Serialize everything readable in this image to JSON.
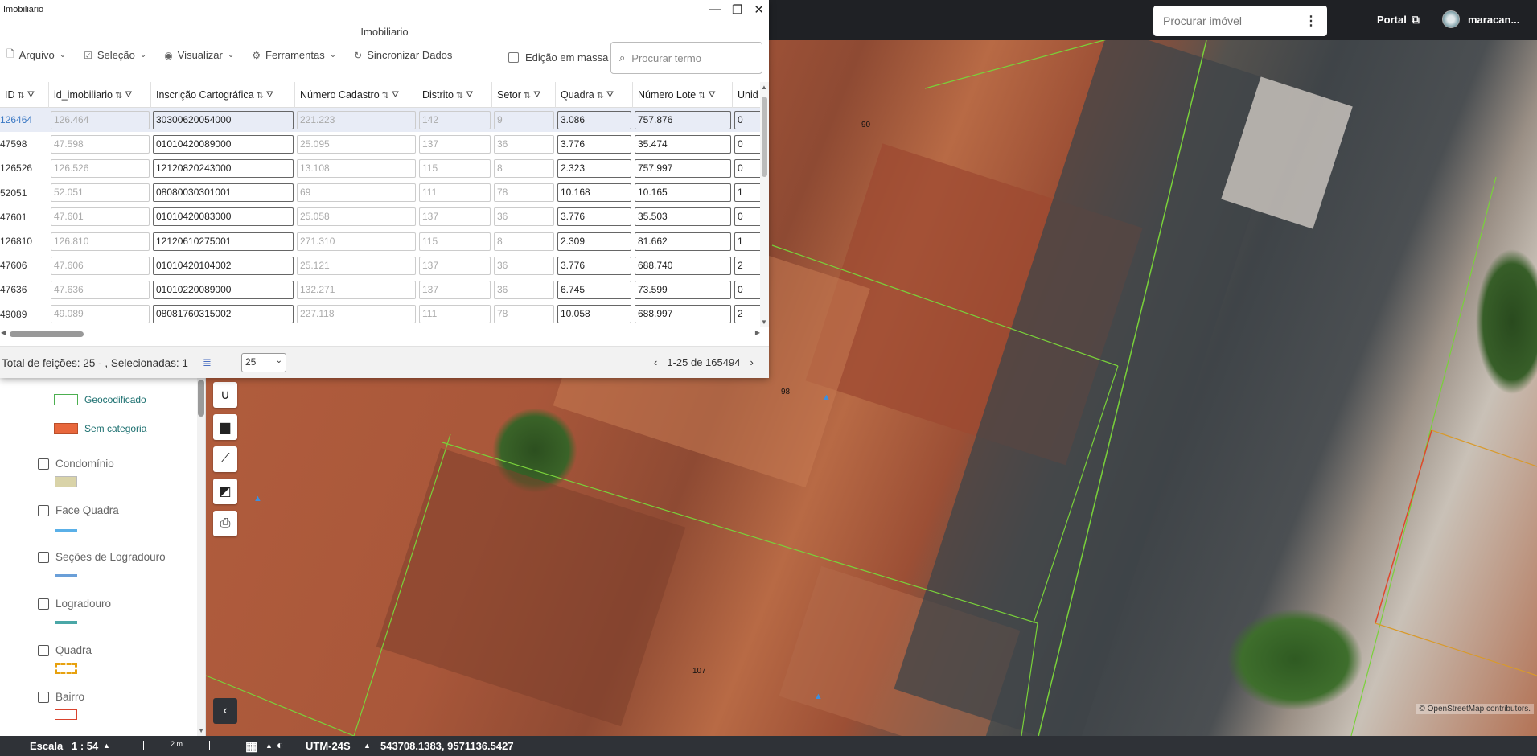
{
  "window": {
    "title": "Imobiliario",
    "heading": "Imobiliario",
    "menu": [
      {
        "label": "Arquivo",
        "icon": "file-icon"
      },
      {
        "label": "Seleção",
        "icon": "checkbox-icon"
      },
      {
        "label": "Visualizar",
        "icon": "eye-icon"
      },
      {
        "label": "Ferramentas",
        "icon": "gear-icon"
      },
      {
        "label": "Sincronizar Dados",
        "icon": "sync-icon"
      }
    ],
    "bulk_edit_label": "Edição em massa",
    "search_placeholder": "Procurar termo"
  },
  "table": {
    "columns": [
      "ID",
      "id_imobiliario",
      "Inscrição Cartográfica",
      "Número Cadastro",
      "Distrito",
      "Setor",
      "Quadra",
      "Número Lote",
      "Unid"
    ],
    "rows": [
      {
        "id": "126464",
        "id_imobiliario": "126.464",
        "inscricao": "30300620054000",
        "cadastro": "221.223",
        "distrito": "142",
        "setor": "9",
        "quadra": "3.086",
        "lote": "757.876",
        "unid": "0",
        "selected": true
      },
      {
        "id": "47598",
        "id_imobiliario": "47.598",
        "inscricao": "01010420089000",
        "cadastro": "25.095",
        "distrito": "137",
        "setor": "36",
        "quadra": "3.776",
        "lote": "35.474",
        "unid": "0"
      },
      {
        "id": "126526",
        "id_imobiliario": "126.526",
        "inscricao": "12120820243000",
        "cadastro": "13.108",
        "distrito": "115",
        "setor": "8",
        "quadra": "2.323",
        "lote": "757.997",
        "unid": "0"
      },
      {
        "id": "52051",
        "id_imobiliario": "52.051",
        "inscricao": "08080030301001",
        "cadastro": "69",
        "distrito": "111",
        "setor": "78",
        "quadra": "10.168",
        "lote": "10.165",
        "unid": "1"
      },
      {
        "id": "47601",
        "id_imobiliario": "47.601",
        "inscricao": "01010420083000",
        "cadastro": "25.058",
        "distrito": "137",
        "setor": "36",
        "quadra": "3.776",
        "lote": "35.503",
        "unid": "0"
      },
      {
        "id": "126810",
        "id_imobiliario": "126.810",
        "inscricao": "12120610275001",
        "cadastro": "271.310",
        "distrito": "115",
        "setor": "8",
        "quadra": "2.309",
        "lote": "81.662",
        "unid": "1"
      },
      {
        "id": "47606",
        "id_imobiliario": "47.606",
        "inscricao": "01010420104002",
        "cadastro": "25.121",
        "distrito": "137",
        "setor": "36",
        "quadra": "3.776",
        "lote": "688.740",
        "unid": "2"
      },
      {
        "id": "47636",
        "id_imobiliario": "47.636",
        "inscricao": "01010220089000",
        "cadastro": "132.271",
        "distrito": "137",
        "setor": "36",
        "quadra": "6.745",
        "lote": "73.599",
        "unid": "0"
      },
      {
        "id": "49089",
        "id_imobiliario": "49.089",
        "inscricao": "08081760315002",
        "cadastro": "227.118",
        "distrito": "111",
        "setor": "78",
        "quadra": "10.058",
        "lote": "688.997",
        "unid": "2"
      }
    ]
  },
  "footer": {
    "total_text": "Total de feições: 25 - , Selecionadas: 1",
    "page_size": "25",
    "range": "1-25 de 165494"
  },
  "topbar": {
    "property_search_placeholder": "Procurar imóvel",
    "portal_label": "Portal",
    "username": "maracan..."
  },
  "layers": {
    "legend": [
      {
        "label": "Geocodificado",
        "color": "#4caf50"
      },
      {
        "label": "Sem categoria",
        "color": "#e8673c"
      }
    ],
    "items": [
      {
        "label": "Condomínio"
      },
      {
        "label": "Face Quadra"
      },
      {
        "label": "Seções de Logradouro"
      },
      {
        "label": "Logradouro"
      },
      {
        "label": "Quadra"
      },
      {
        "label": "Bairro"
      }
    ]
  },
  "map": {
    "labels": [
      "90",
      "98",
      "107"
    ],
    "attribution": "© OpenStreetMap contributors."
  },
  "status": {
    "scale_label": "Escala",
    "scale_value": "1 : 54",
    "scalebar_text": "2 m",
    "crs": "UTM-24S",
    "coords": "543708.1383, 9571136.5427"
  }
}
